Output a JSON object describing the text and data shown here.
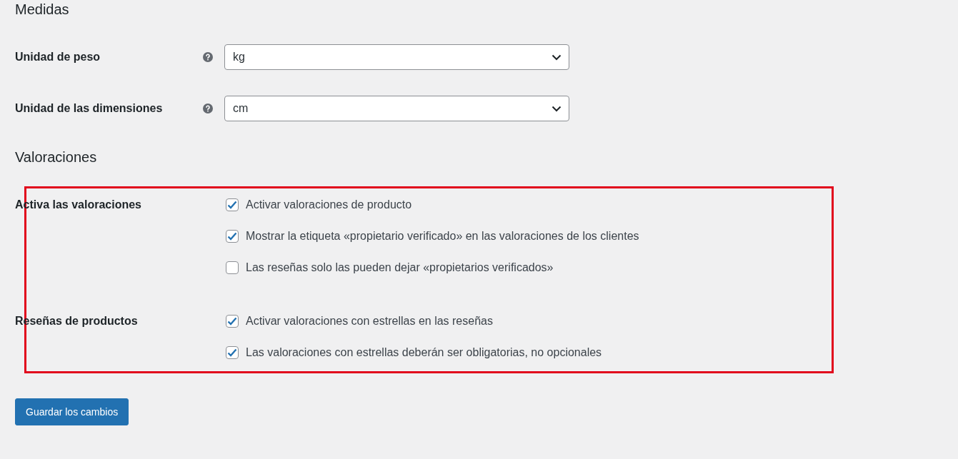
{
  "sections": [
    {
      "title": "Medidas",
      "fields": [
        {
          "kind": "select",
          "label": "Unidad de peso",
          "help": true,
          "value": "kg"
        },
        {
          "kind": "select",
          "label": "Unidad de las dimensiones",
          "help": true,
          "value": "cm"
        }
      ]
    },
    {
      "title": "Valoraciones",
      "fields": [
        {
          "kind": "checkboxes",
          "label": "Activa las valoraciones",
          "options": [
            {
              "label": "Activar valoraciones de producto",
              "checked": true
            },
            {
              "label": "Mostrar la etiqueta «propietario verificado» en las valoraciones de los clientes",
              "checked": true
            },
            {
              "label": "Las reseñas solo las pueden dejar «propietarios verificados»",
              "checked": false
            }
          ]
        },
        {
          "kind": "checkboxes",
          "label": "Reseñas de productos",
          "options": [
            {
              "label": "Activar valoraciones con estrellas en las reseñas",
              "checked": true
            },
            {
              "label": "Las valoraciones con estrellas deberán ser obligatorias, no opcionales",
              "checked": true
            }
          ]
        }
      ]
    }
  ],
  "save_button": "Guardar los cambios"
}
